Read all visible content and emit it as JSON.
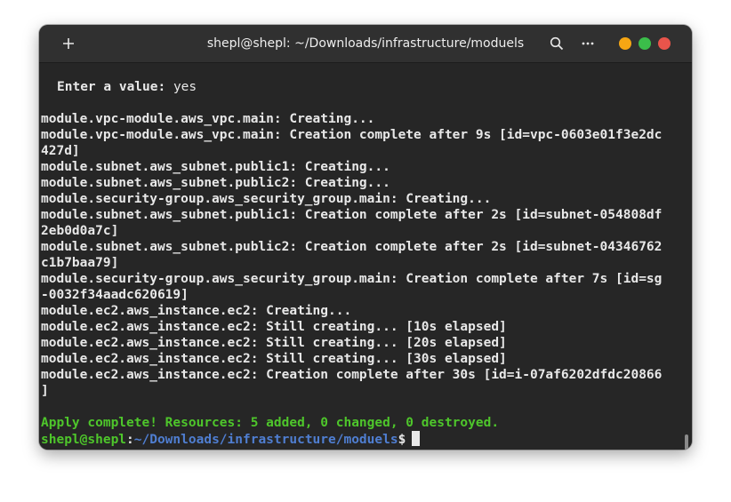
{
  "window": {
    "title": "shepl@shepl: ~/Downloads/infrastructure/moduels",
    "colors": {
      "minimize": "#f6a613",
      "maximize": "#3bbd4a",
      "close": "#e9544b"
    },
    "icons": {
      "new_tab": "plus-icon",
      "search": "search-icon",
      "menu": "ellipsis-icon"
    }
  },
  "terminal": {
    "prompt_label": "Enter a value:",
    "prompt_value": " yes",
    "output": [
      "module.vpc-module.aws_vpc.main: Creating...",
      "module.vpc-module.aws_vpc.main: Creation complete after 9s [id=vpc-0603e01f3e2dc",
      "427d]",
      "module.subnet.aws_subnet.public1: Creating...",
      "module.subnet.aws_subnet.public2: Creating...",
      "module.security-group.aws_security_group.main: Creating...",
      "module.subnet.aws_subnet.public1: Creation complete after 2s [id=subnet-054808df",
      "2eb0d0a7c]",
      "module.subnet.aws_subnet.public2: Creation complete after 2s [id=subnet-04346762",
      "c1b7baa79]",
      "module.security-group.aws_security_group.main: Creation complete after 7s [id=sg",
      "-0032f34aadc620619]",
      "module.ec2.aws_instance.ec2: Creating...",
      "module.ec2.aws_instance.ec2: Still creating... [10s elapsed]",
      "module.ec2.aws_instance.ec2: Still creating... [20s elapsed]",
      "module.ec2.aws_instance.ec2: Still creating... [30s elapsed]",
      "module.ec2.aws_instance.ec2: Creation complete after 30s [id=i-07af6202dfdc20866",
      "]"
    ],
    "apply_message": "Apply complete! Resources: 5 added, 0 changed, 0 destroyed.",
    "shell_user": "shepl@shepl",
    "shell_sep": ":",
    "shell_path": "~/Downloads/infrastructure/moduels",
    "shell_symbol": "$"
  }
}
